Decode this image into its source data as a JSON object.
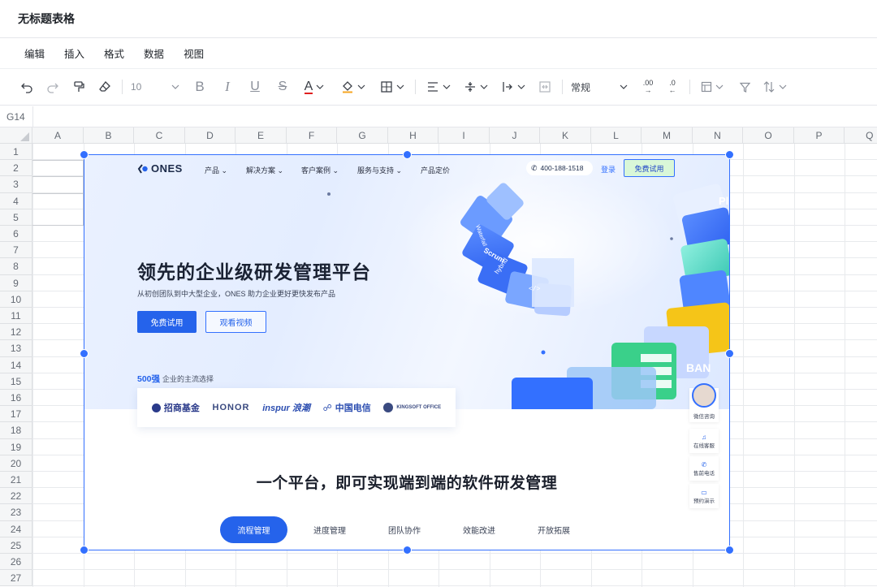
{
  "doc": {
    "title": "无标题表格"
  },
  "menu": [
    "编辑",
    "插入",
    "格式",
    "数据",
    "视图"
  ],
  "toolbar": {
    "font_size": "10",
    "number_format": "常规",
    "decimal_increase": ".00",
    "decimal_decrease": ".0",
    "colors": {
      "text_underline": "#e02020",
      "fill_underline": "#f5a623",
      "accent": "#3370ff"
    }
  },
  "name_box": "G14",
  "columns": [
    "A",
    "B",
    "C",
    "D",
    "E",
    "F",
    "G",
    "H",
    "I",
    "J",
    "K",
    "L",
    "M",
    "N",
    "O",
    "P",
    "Q"
  ],
  "rows": [
    "1",
    "2",
    "3",
    "4",
    "5",
    "6",
    "7",
    "8",
    "9",
    "10",
    "11",
    "12",
    "13",
    "14",
    "15",
    "16",
    "17",
    "18",
    "19",
    "20",
    "21",
    "22",
    "23",
    "24",
    "25",
    "26",
    "27"
  ],
  "embed": {
    "nav": {
      "logo": "ONES",
      "items": [
        "产品 ⌄",
        "解决方案 ⌄",
        "客户案例 ⌄",
        "服务与支持 ⌄",
        "产品定价"
      ],
      "phone": "400-188-1518",
      "login": "登录",
      "trial": "免费试用"
    },
    "hero": {
      "headline": "领先的企业级研发管理平台",
      "subline": "从初创团队到中大型企业，ONES 助力企业更好更快发布产品",
      "btn_trial": "免费试用",
      "btn_video": "观看视频",
      "rank_strong": "500强",
      "rank_text": "企业的主流选择",
      "customers": [
        "招商基金",
        "HONOR",
        "inspur 浪潮",
        "中国电信",
        "KINGSOFT OFFICE"
      ]
    },
    "section": {
      "title": "一个平台，即可实现端到端的软件研发管理",
      "tabs": [
        "流程管理",
        "进度管理",
        "团队协作",
        "效能改进",
        "开放拓展"
      ]
    },
    "side": [
      "微信咨询",
      "在线客服",
      "售前电话",
      "预约演示"
    ],
    "deco": [
      "Scrum",
      "hybrid",
      "Waterfall",
      "BAN",
      "Pl",
      "</>"
    ]
  }
}
